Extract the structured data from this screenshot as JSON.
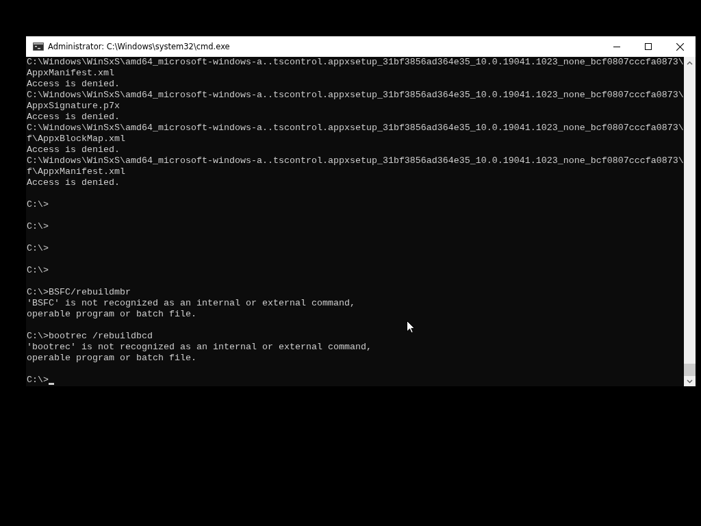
{
  "window": {
    "title": "Administrator: C:\\Windows\\system32\\cmd.exe"
  },
  "console": {
    "blocks": [
      {
        "lines": [
          "C:\\Windows\\WinSxS\\amd64_microsoft-windows-a..tscontrol.appxsetup_31bf3856ad364e35_10.0.19041.1023_none_bcf0807cccfa0873\\",
          "AppxManifest.xml",
          "Access is denied.",
          "C:\\Windows\\WinSxS\\amd64_microsoft-windows-a..tscontrol.appxsetup_31bf3856ad364e35_10.0.19041.1023_none_bcf0807cccfa0873\\",
          "AppxSignature.p7x",
          "Access is denied.",
          "C:\\Windows\\WinSxS\\amd64_microsoft-windows-a..tscontrol.appxsetup_31bf3856ad364e35_10.0.19041.1023_none_bcf0807cccfa0873\\",
          "f\\AppxBlockMap.xml",
          "Access is denied.",
          "C:\\Windows\\WinSxS\\amd64_microsoft-windows-a..tscontrol.appxsetup_31bf3856ad364e35_10.0.19041.1023_none_bcf0807cccfa0873\\",
          "f\\AppxManifest.xml",
          "Access is denied."
        ]
      },
      {
        "lines": [
          "C:\\>"
        ]
      },
      {
        "lines": [
          "C:\\>"
        ]
      },
      {
        "lines": [
          "C:\\>"
        ]
      },
      {
        "lines": [
          "C:\\>"
        ]
      },
      {
        "lines": [
          "C:\\>BSFC/rebuildmbr",
          "'BSFC' is not recognized as an internal or external command,",
          "operable program or batch file."
        ]
      },
      {
        "lines": [
          "C:\\>bootrec /rebuildbcd",
          "'bootrec' is not recognized as an internal or external command,",
          "operable program or batch file."
        ]
      },
      {
        "lines": [
          "C:\\>"
        ]
      }
    ],
    "cursor": true
  }
}
